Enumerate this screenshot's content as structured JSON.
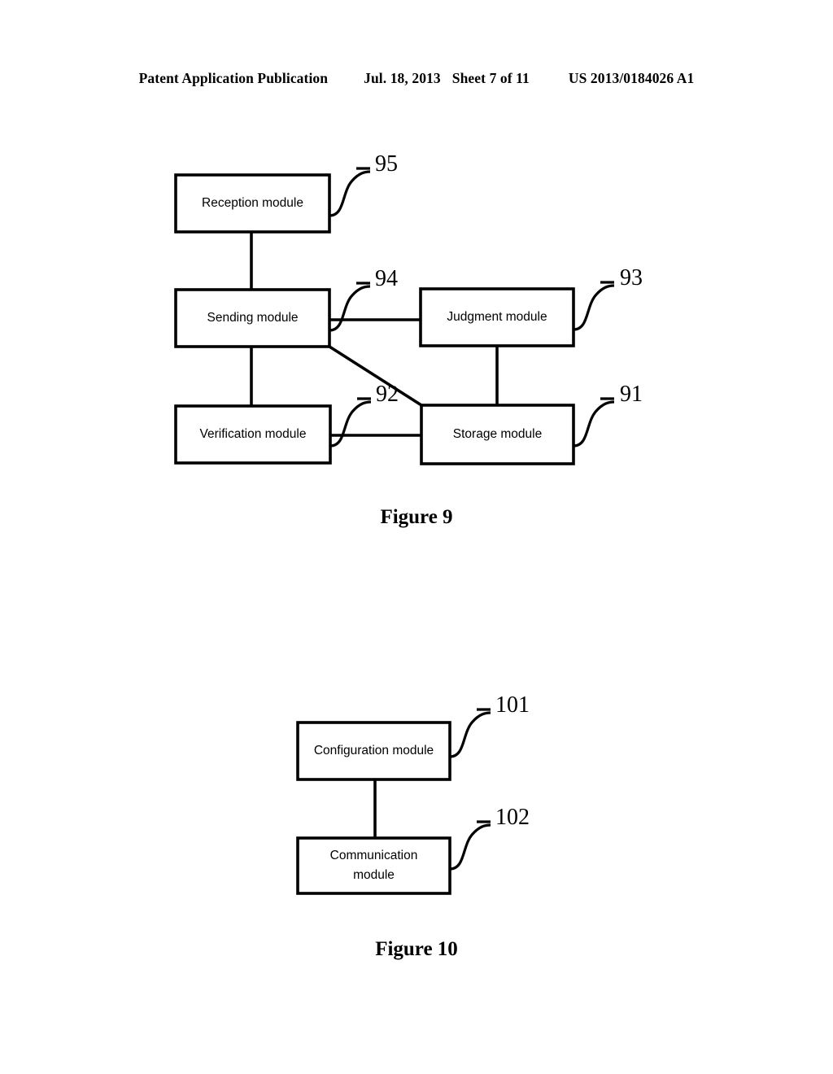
{
  "header": {
    "publication": "Patent Application Publication",
    "date": "Jul. 18, 2013",
    "sheet": "Sheet 7 of 11",
    "patent_number": "US 2013/0184026 A1"
  },
  "figures": [
    {
      "caption": "Figure 9",
      "boxes": [
        {
          "id": "reception",
          "label": "Reception module",
          "ref": "95"
        },
        {
          "id": "sending",
          "label": "Sending module",
          "ref": "94"
        },
        {
          "id": "judgment",
          "label": "Judgment module",
          "ref": "93"
        },
        {
          "id": "verification",
          "label": "Verification module",
          "ref": "92"
        },
        {
          "id": "storage",
          "label": "Storage module",
          "ref": "91"
        }
      ]
    },
    {
      "caption": "Figure 10",
      "boxes": [
        {
          "id": "configuration",
          "label": "Configuration module",
          "ref": "101"
        },
        {
          "id": "communication",
          "label": "Communication\nmodule",
          "ref": "102"
        }
      ]
    }
  ],
  "style": {
    "ink": "#000000",
    "paper": "#ffffff"
  }
}
